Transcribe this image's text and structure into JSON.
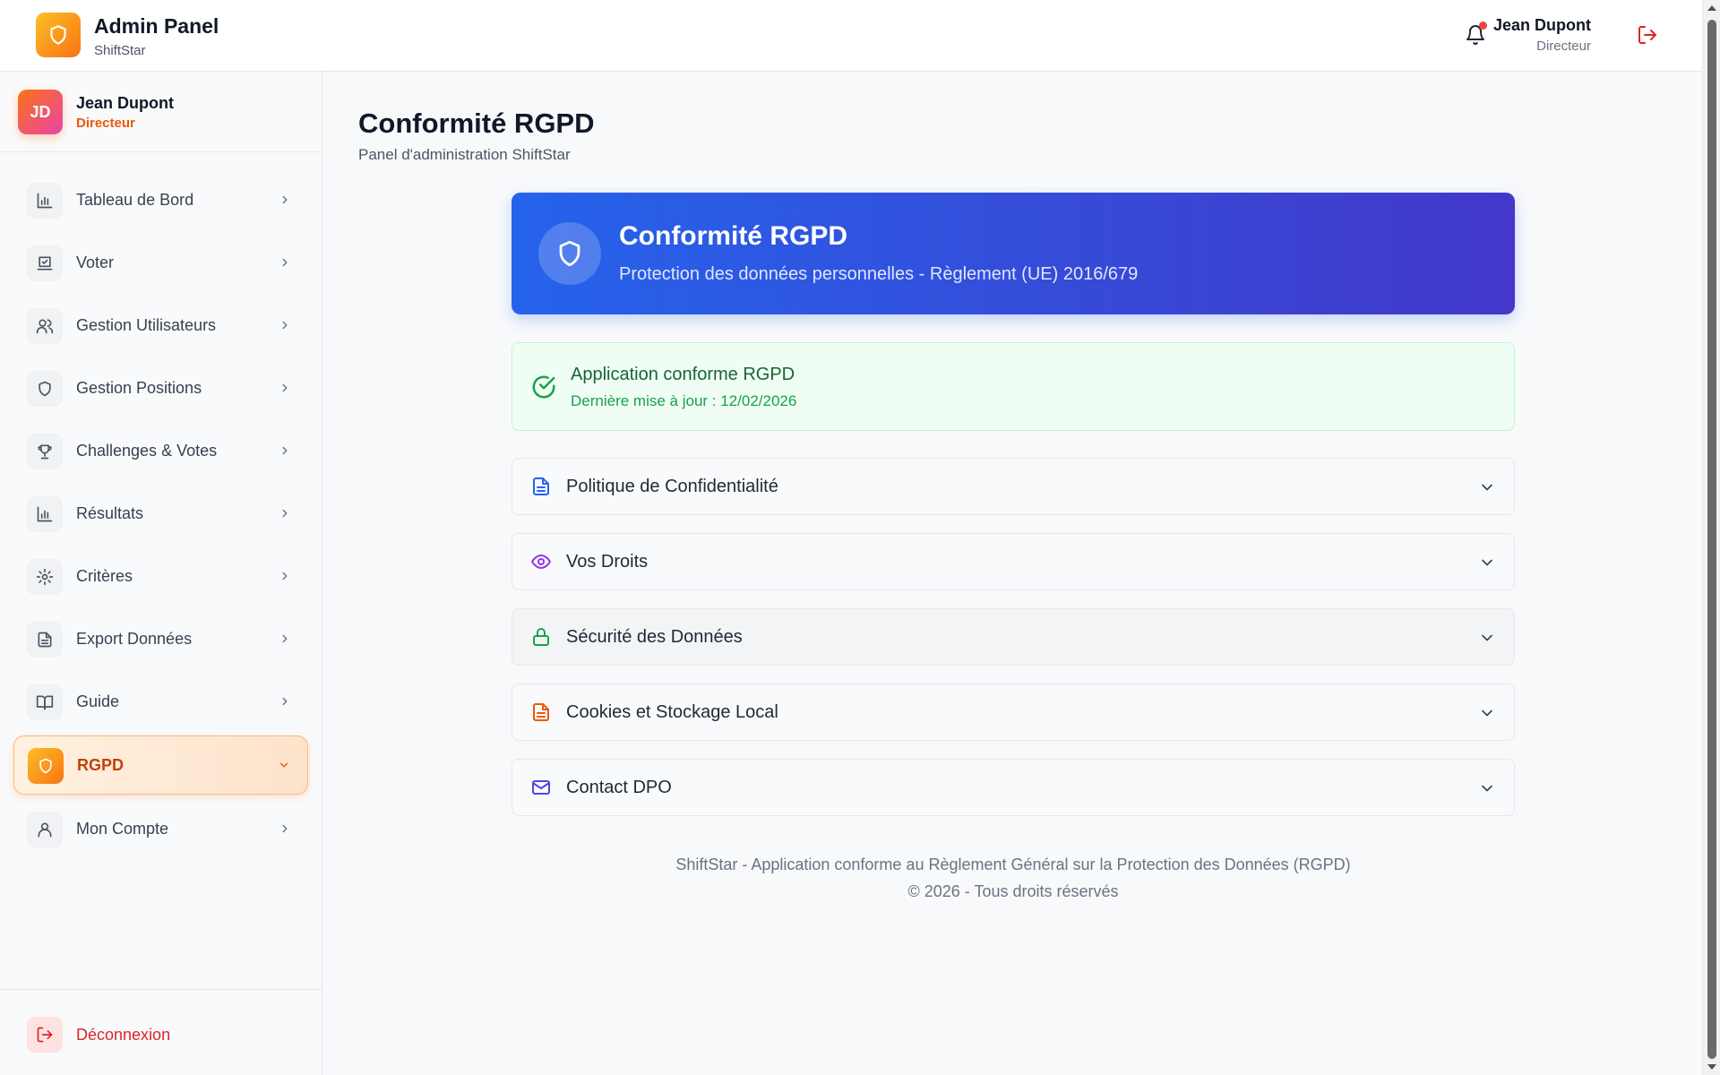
{
  "header": {
    "brand_title": "Admin Panel",
    "brand_subtitle": "ShiftStar",
    "logo_icon": "shield-icon",
    "notifications_icon": "bell-icon",
    "user_name": "Jean Dupont",
    "user_role": "Directeur",
    "logout_icon": "logout-icon"
  },
  "sidebar": {
    "profile": {
      "initials": "JD",
      "name": "Jean Dupont",
      "role": "Directeur"
    },
    "items": [
      {
        "label": "Tableau de Bord",
        "icon": "bar-chart-icon"
      },
      {
        "label": "Voter",
        "icon": "ballot-box-icon"
      },
      {
        "label": "Gestion Utilisateurs",
        "icon": "users-icon"
      },
      {
        "label": "Gestion Positions",
        "icon": "shield-icon"
      },
      {
        "label": "Challenges & Votes",
        "icon": "trophy-icon"
      },
      {
        "label": "Résultats",
        "icon": "bar-chart-icon"
      },
      {
        "label": "Critères",
        "icon": "gear-icon"
      },
      {
        "label": "Export Données",
        "icon": "document-icon"
      },
      {
        "label": "Guide",
        "icon": "book-icon"
      },
      {
        "label": "RGPD",
        "icon": "shield-icon",
        "active": true
      },
      {
        "label": "Mon Compte",
        "icon": "user-icon"
      }
    ],
    "logout_label": "Déconnexion"
  },
  "main": {
    "title": "Conformité RGPD",
    "subtitle": "Panel d'administration ShiftStar",
    "hero": {
      "title": "Conformité RGPD",
      "subtitle": "Protection des données personnelles - Règlement (UE) 2016/679"
    },
    "status": {
      "title": "Application conforme RGPD",
      "subtitle": "Dernière mise à jour : 12/02/2026"
    },
    "sections": [
      {
        "label": "Politique de Confidentialité",
        "icon": "document-icon",
        "color": "#2563eb"
      },
      {
        "label": "Vos Droits",
        "icon": "eye-icon",
        "color": "#9333ea"
      },
      {
        "label": "Sécurité des Données",
        "icon": "lock-icon",
        "color": "#16a34a"
      },
      {
        "label": "Cookies et Stockage Local",
        "icon": "document-icon",
        "color": "#ea580c"
      },
      {
        "label": "Contact DPO",
        "icon": "mail-icon",
        "color": "#4f46e5"
      }
    ]
  },
  "footer": {
    "line1": "ShiftStar - Application conforme au Règlement Général sur la Protection des Données (RGPD)",
    "line2": "© 2026 - Tous droits réservés"
  },
  "colors": {
    "accent_orange": "#f97316",
    "hero_start": "#2563eb",
    "hero_end": "#4338ca",
    "success": "#16a34a",
    "danger": "#dc2626"
  }
}
